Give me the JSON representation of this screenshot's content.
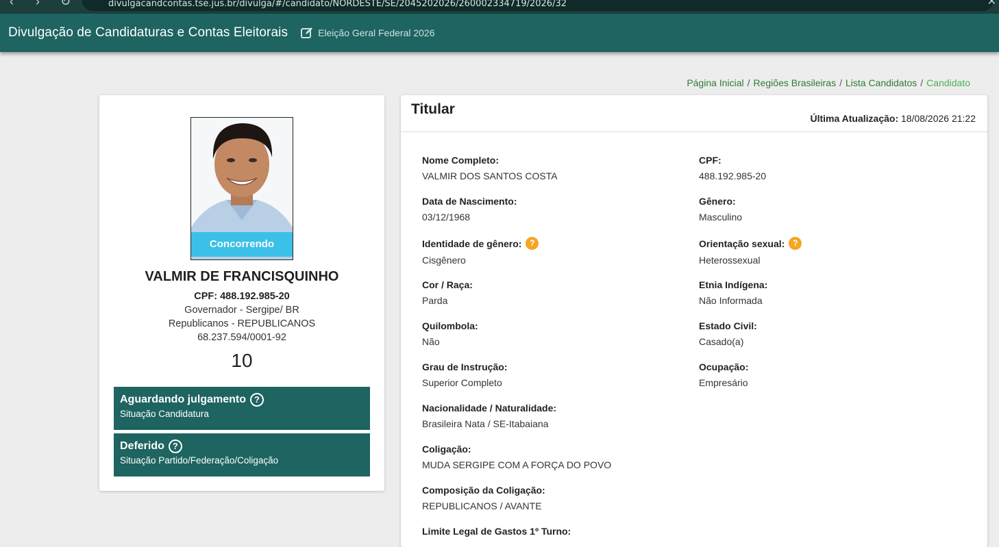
{
  "browser": {
    "url": "divulgacandcontas.tse.jus.br/divulga/#/candidato/NORDESTE/SE/2045202026/260002334719/2026/32",
    "back_icon": "arrow-left-icon",
    "forward_icon": "arrow-right-icon",
    "reload_icon": "reload-icon"
  },
  "header": {
    "title": "Divulgação de Candidaturas e Contas Eleitorais",
    "election": "Eleição Geral Federal 2026",
    "election_icon": "edit-icon"
  },
  "breadcrumb": {
    "items": [
      "Página Inicial",
      "Regiões Brasileiras",
      "Lista Candidatos"
    ],
    "current": "Candidato",
    "separator": "/"
  },
  "candidate": {
    "status_pill": "Concorrendo",
    "name": "VALMIR DE FRANCISQUINHO",
    "cpf_line": "CPF: 488.192.985-20",
    "office": "Governador - Sergipe/ BR",
    "party": "Republicanos - REPUBLICANOS",
    "cnpj": "68.237.594/0001-92",
    "number": "10",
    "situations": [
      {
        "title": "Aguardando julgamento",
        "subtitle": "Situação Candidatura"
      },
      {
        "title": "Deferido",
        "subtitle": "Situação Partido/Federação/Coligação"
      }
    ]
  },
  "detail": {
    "title": "Titular",
    "last_update_label": "Última Atualização:",
    "last_update_value": "18/08/2026 21:22",
    "fields": {
      "nome": {
        "label": "Nome Completo:",
        "value": "VALMIR DOS SANTOS COSTA"
      },
      "cpf": {
        "label": "CPF:",
        "value": "488.192.985-20"
      },
      "nascimento": {
        "label": "Data de Nascimento:",
        "value": "03/12/1968"
      },
      "genero": {
        "label": "Gênero:",
        "value": "Masculino"
      },
      "identidade": {
        "label": "Identidade de gênero:",
        "value": "Cisgênero"
      },
      "orientacao": {
        "label": "Orientação sexual:",
        "value": "Heterossexual"
      },
      "cor": {
        "label": "Cor / Raça:",
        "value": "Parda"
      },
      "etnia": {
        "label": "Etnia Indígena:",
        "value": "Não Informada"
      },
      "quilombola": {
        "label": "Quilombola:",
        "value": "Não"
      },
      "estado_civil": {
        "label": "Estado Civil:",
        "value": "Casado(a)"
      },
      "instrucao": {
        "label": "Grau de Instrução:",
        "value": "Superior Completo"
      },
      "ocupacao": {
        "label": "Ocupação:",
        "value": "Empresário"
      },
      "nacionalidade": {
        "label": "Nacionalidade / Naturalidade:",
        "value": "Brasileira Nata / SE-Itabaiana"
      },
      "coligacao": {
        "label": "Coligação:",
        "value": "MUDA SERGIPE COM A FORÇA DO POVO"
      },
      "composicao": {
        "label": "Composição da Coligação:",
        "value": "REPUBLICANOS / AVANTE"
      },
      "limite": {
        "label": "Limite Legal de Gastos 1º Turno:"
      }
    },
    "help_mark": "?"
  },
  "colors": {
    "header_bg": "#1e6461",
    "status_box_bg": "#1e6461",
    "pill_bg": "#35c1e8",
    "info_dot": "#f5a623",
    "breadcrumb_link": "#2e7d32",
    "page_bg": "#ededed"
  }
}
